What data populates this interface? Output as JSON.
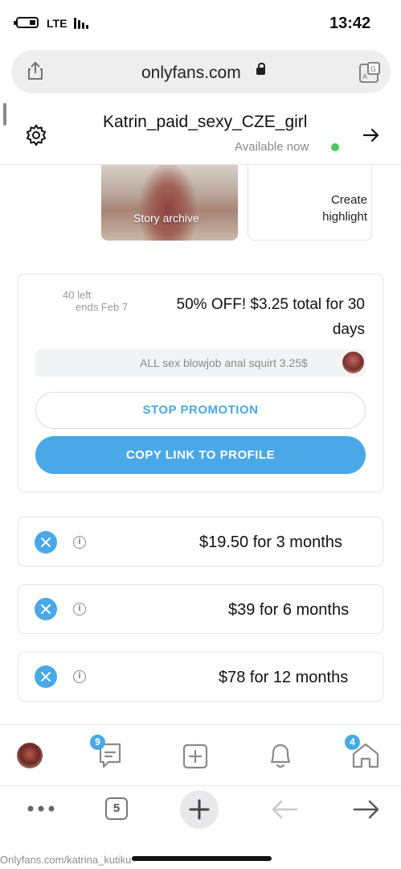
{
  "status_bar": {
    "time": "13:42",
    "network": "LTE",
    "battery_level": 0.3
  },
  "browser": {
    "url": "onlyfans.com",
    "share_icon": "share-icon",
    "reader_icon": "translate-icon"
  },
  "header": {
    "username": "Katrin_paid_sexy_CZE_girl",
    "status": "Available now",
    "status_color": "#4cc764",
    "settings_icon": "gear-icon",
    "back_icon": "arrow-icon"
  },
  "highlights": [
    {
      "label": "Story archive"
    },
    {
      "label": "Create\nhighlight"
    }
  ],
  "promotion": {
    "title": "50% OFF! $3.25 total for 30 days",
    "left": "40 left",
    "ends": "ends Feb 7",
    "message": "ALL sex blowjob anal squirt 3.25$",
    "stop_label": "STOP PROMOTION",
    "copy_label": "COPY LINK TO PROFILE",
    "accent": "#4aa8e6"
  },
  "bundles": [
    {
      "label": "$19.50 for 3 months"
    },
    {
      "label": "$39 for 6 months"
    },
    {
      "label": "$78 for 12 months"
    }
  ],
  "app_nav": {
    "messages_badge": "9",
    "home_badge": "4"
  },
  "browser_nav": {
    "tabs_count": "5"
  },
  "footer": {
    "watermark": "Onlyfans.com/katrina_kutiku"
  }
}
